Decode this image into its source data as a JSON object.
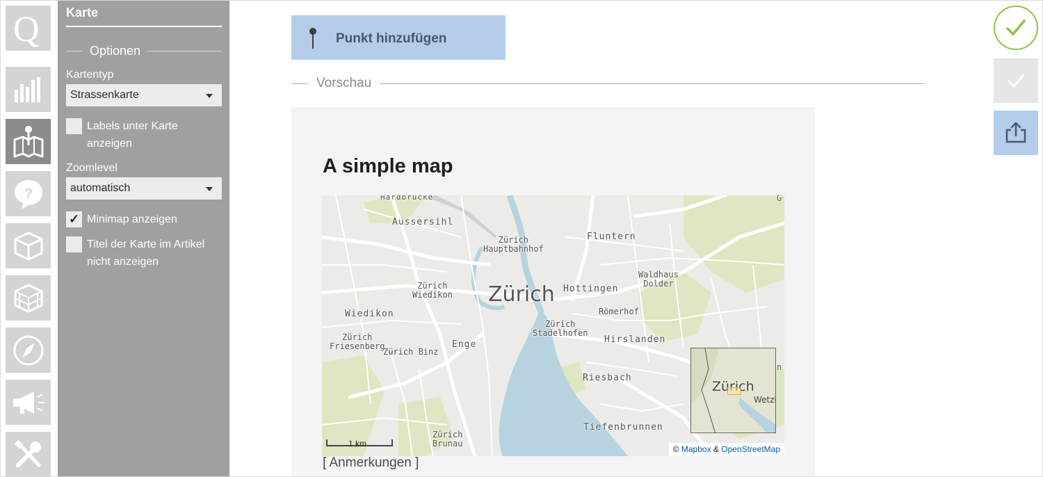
{
  "app": {
    "rail": [
      {
        "name": "q-logo",
        "icon": "q-logo-icon"
      },
      {
        "name": "chart",
        "icon": "bar-chart-icon"
      },
      {
        "name": "map",
        "icon": "map-icon",
        "active": true
      },
      {
        "name": "question",
        "icon": "question-icon"
      },
      {
        "name": "box",
        "icon": "box-icon"
      },
      {
        "name": "cube-grid",
        "icon": "cube-grid-icon"
      },
      {
        "name": "compass",
        "icon": "compass-icon"
      },
      {
        "name": "megaphone",
        "icon": "megaphone-icon"
      },
      {
        "name": "tools",
        "icon": "tools-icon"
      }
    ]
  },
  "panel": {
    "title": "Karte",
    "options_heading": "Optionen",
    "map_type_label": "Kartentyp",
    "map_type_value": "Strassenkarte",
    "labels_below_map": "Labels unter Karte anzeigen",
    "zoom_label": "Zoomlevel",
    "zoom_value": "automatisch",
    "minimap_label": "Minimap anzeigen",
    "minimap_checked": true,
    "hide_title_label": "Titel der Karte im Artikel nicht anzeigen"
  },
  "main": {
    "add_point_label": "Punkt hinzufügen",
    "preview_heading": "Vorschau",
    "map_title": "A simple map",
    "notes": "[ Anmerkungen ]",
    "scale_label": "1 km",
    "attribution": {
      "prefix": "©",
      "mapbox": "Mapbox",
      "and": "&",
      "osm": "OpenStreetMap"
    },
    "places": {
      "hardbruecke": "Hardbrücke",
      "aussersihl": "Aussersihl",
      "zurich_hb": "Zürich\nHauptbahnhof",
      "fluntern": "Fluntern",
      "zurich_wiedikon": "Zürich\nWiedikon",
      "zurich": "Zürich",
      "hottingen": "Hottingen",
      "waldhaus": "Waldhaus\nDolder",
      "wiedikon": "Wiedikon",
      "roemerhof": "Römerhof",
      "zurich_stadelhofen": "Zürich\nStadelhofen",
      "zurich_friesenberg": "Zürich\nFriesenberg",
      "enge": "Enge",
      "hirslanden": "Hirslanden",
      "zurich_binz": "Zürich Binz",
      "riesbach": "Riesbach",
      "tiefenbrunnen": "Tiefenbrunnen",
      "zurich_brunau": "Zürich\nBrunau",
      "edge_g": "G",
      "edge_n": "n"
    },
    "minimap": {
      "label": "Zürich",
      "side_label": "Wetzi"
    }
  },
  "colors": {
    "panel_bg": "#a0a0a3",
    "add_point_bg": "#b3cdeb",
    "save_green": "#8bc34a",
    "share_bg": "#b3cdeb",
    "water": "#b6d3df",
    "park": "#dfe6c2"
  },
  "actions": {
    "save_icon": "checkmark-circle-icon",
    "confirm_icon": "check-icon",
    "share_icon": "share-icon"
  }
}
